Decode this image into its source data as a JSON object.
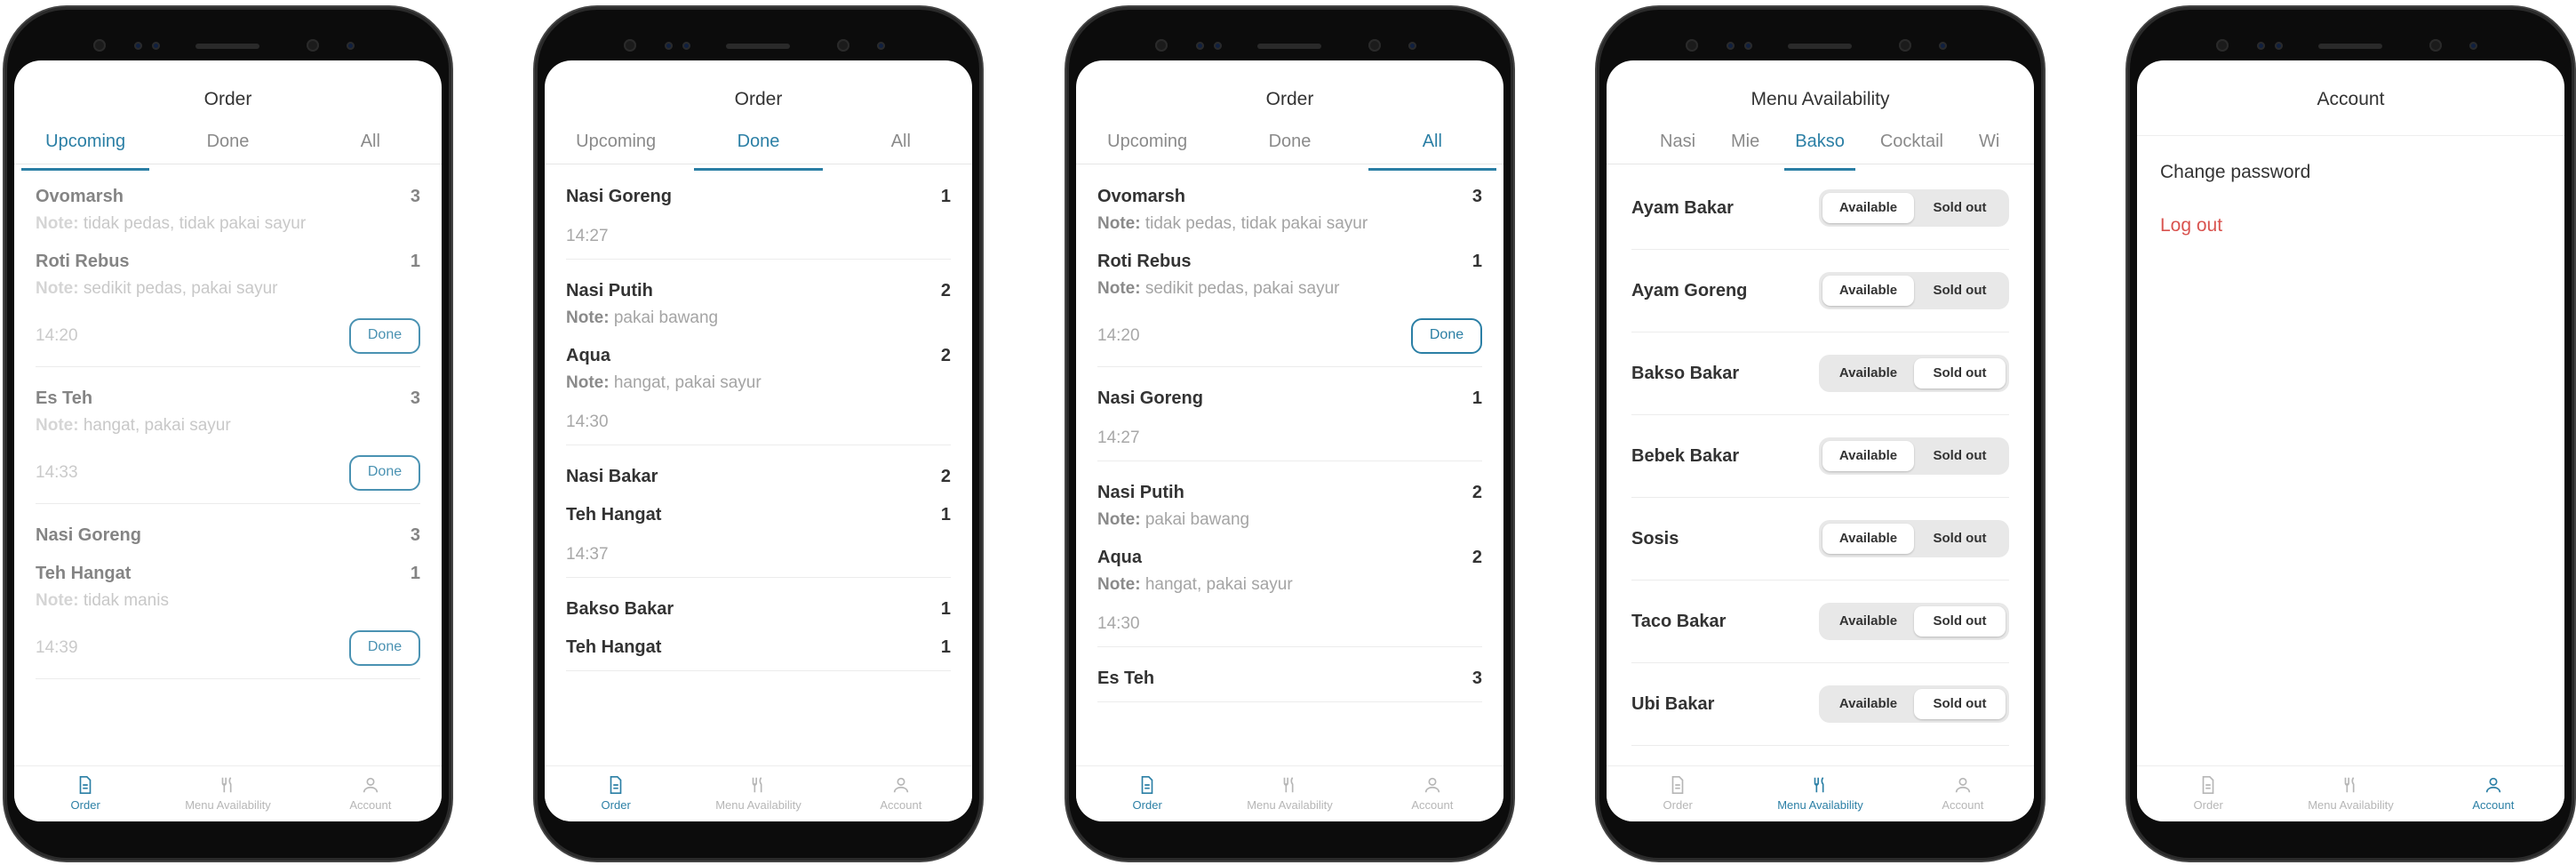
{
  "nav": {
    "order": "Order",
    "menu": "Menu Availability",
    "account": "Account"
  },
  "screen1": {
    "title": "Order",
    "tabs": [
      "Upcoming",
      "Done",
      "All"
    ],
    "orders": [
      {
        "items": [
          {
            "name": "Ovomarsh",
            "qty": "3",
            "note": "tidak pedas, tidak pakai sayur"
          },
          {
            "name": "Roti Rebus",
            "qty": "1",
            "note": "sedikit pedas, pakai sayur"
          }
        ],
        "time": "14:20",
        "button": "Done"
      },
      {
        "items": [
          {
            "name": "Es Teh",
            "qty": "3",
            "note": "hangat, pakai sayur"
          }
        ],
        "time": "14:33",
        "button": "Done"
      },
      {
        "items": [
          {
            "name": "Nasi Goreng",
            "qty": "3",
            "note": ""
          },
          {
            "name": "Teh Hangat",
            "qty": "1",
            "note": "tidak manis"
          }
        ],
        "time": "14:39",
        "button": "Done"
      }
    ]
  },
  "screen2": {
    "title": "Order",
    "tabs": [
      "Upcoming",
      "Done",
      "All"
    ],
    "orders": [
      {
        "items": [
          {
            "name": "Nasi Goreng",
            "qty": "1",
            "note": ""
          }
        ],
        "time": "14:27"
      },
      {
        "items": [
          {
            "name": "Nasi Putih",
            "qty": "2",
            "note": "pakai bawang"
          },
          {
            "name": "Aqua",
            "qty": "2",
            "note": "hangat, pakai sayur"
          }
        ],
        "time": "14:30"
      },
      {
        "items": [
          {
            "name": "Nasi Bakar",
            "qty": "2",
            "note": ""
          },
          {
            "name": "Teh Hangat",
            "qty": "1",
            "note": ""
          }
        ],
        "time": "14:37"
      },
      {
        "items": [
          {
            "name": "Bakso Bakar",
            "qty": "1",
            "note": ""
          },
          {
            "name": "Teh Hangat",
            "qty": "1",
            "note": ""
          }
        ],
        "time": ""
      }
    ]
  },
  "screen3": {
    "title": "Order",
    "tabs": [
      "Upcoming",
      "Done",
      "All"
    ],
    "orders": [
      {
        "items": [
          {
            "name": "Ovomarsh",
            "qty": "3",
            "note": "tidak pedas, tidak pakai sayur"
          },
          {
            "name": "Roti Rebus",
            "qty": "1",
            "note": "sedikit pedas, pakai sayur"
          }
        ],
        "time": "14:20",
        "button": "Done"
      },
      {
        "items": [
          {
            "name": "Nasi Goreng",
            "qty": "1",
            "note": ""
          }
        ],
        "time": "14:27"
      },
      {
        "items": [
          {
            "name": "Nasi Putih",
            "qty": "2",
            "note": "pakai bawang"
          },
          {
            "name": "Aqua",
            "qty": "2",
            "note": "hangat, pakai sayur"
          }
        ],
        "time": "14:30"
      },
      {
        "items": [
          {
            "name": "Es Teh",
            "qty": "3",
            "note": ""
          }
        ],
        "time": ""
      }
    ]
  },
  "screen4": {
    "title": "Menu Availability",
    "tabs": [
      "Nasi",
      "Mie",
      "Bakso",
      "Cocktail",
      "Wi"
    ],
    "available_label": "Available",
    "soldout_label": "Sold out",
    "items": [
      {
        "name": "Ayam Bakar",
        "state": "available"
      },
      {
        "name": "Ayam Goreng",
        "state": "available"
      },
      {
        "name": "Bakso Bakar",
        "state": "soldout"
      },
      {
        "name": "Bebek Bakar",
        "state": "available"
      },
      {
        "name": "Sosis",
        "state": "available"
      },
      {
        "name": "Taco Bakar",
        "state": "soldout"
      },
      {
        "name": "Ubi Bakar",
        "state": "soldout"
      }
    ]
  },
  "screen5": {
    "title": "Account",
    "change_password": "Change password",
    "logout": "Log out"
  },
  "colors": {
    "accent": "#2b7fa5",
    "danger": "#d9534f"
  },
  "note_label": "Note:"
}
